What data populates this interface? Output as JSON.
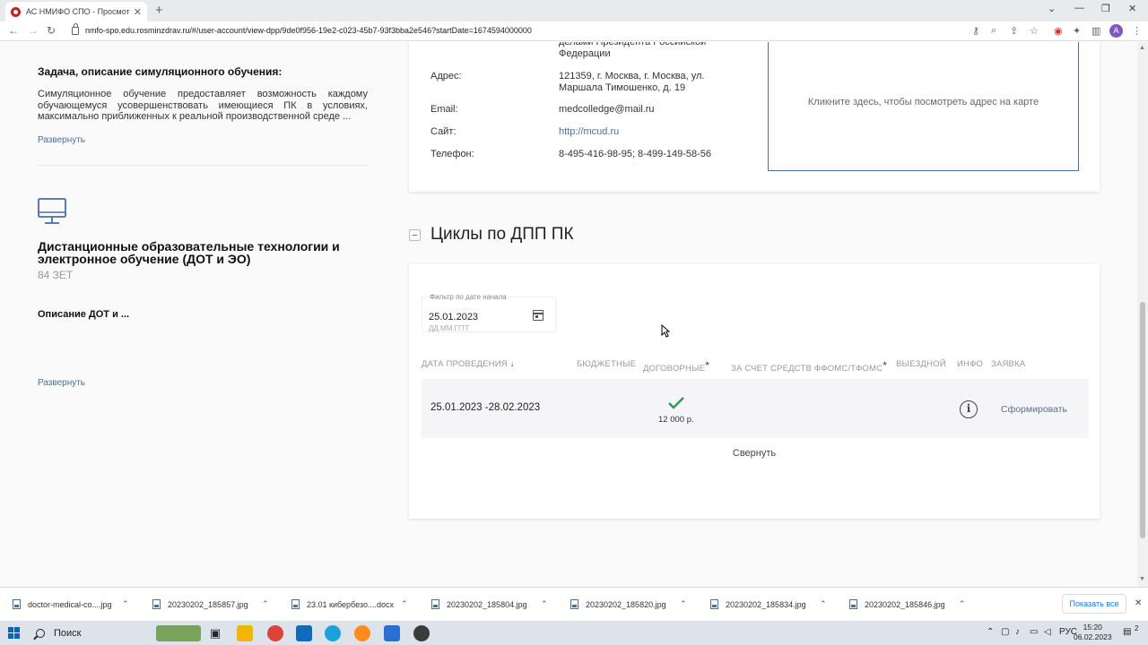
{
  "browser": {
    "tab_title": "АС НМИФО СПО - Просмотр Д",
    "url": "nmfo-spo.edu.rosminzdrav.ru/#/user-account/view-dpp/9de0f956-19e2-c023-45b7-93f3bba2e546?startDate=1674594000000"
  },
  "left": {
    "task_heading": "Задача, описание симуляционного обучения:",
    "task_text": "Симуляционное обучение предоставляет возможность каждому обучающемуся усовершенствовать имеющиеся ПК в условиях, максимально приближенных к реальной производственной среде ...",
    "expand_1": "Развернуть",
    "dot_title": "Дистанционные образовательные технологии и электронное обучение (ДОТ и ЭО)",
    "dot_zet": "84 ЗЕТ",
    "dot_desc": "Описание ДОТ и ...",
    "expand_2": "Развернуть"
  },
  "org_info": {
    "org_tail": "делами Президента Российской Федерации",
    "address_label": "Адрес:",
    "address_value": "121359, г. Москва, г. Москва, ул. Маршала Тимошенко, д. 19",
    "email_label": "Email:",
    "email_value": "medcolledge@mail.ru",
    "site_label": "Сайт:",
    "site_value": "http://mcud.ru",
    "phone_label": "Телефон:",
    "phone_value": "8-495-416-98-95; 8-499-149-58-56",
    "map_text": "Кликните здесь, чтобы посмотреть адрес на карте"
  },
  "cycles": {
    "section_title": "Циклы по ДПП ПК",
    "filter_label": "Фильтр по дате начала",
    "filter_value": "25.01.2023",
    "filter_hint": "ДД.ММ.ГГГГ",
    "columns": {
      "date": "ДАТА ПРОВЕДЕНИЯ",
      "budget": "БЮДЖЕТНЫЕ",
      "contract": "ДОГОВОРНЫЕ",
      "foms": "ЗА СЧЕТ СРЕДСТВ ФФОМС/ТФОМС",
      "offsite": "ВЫЕЗДНОЙ",
      "info": "ИНФО",
      "request": "ЗАЯВКА"
    },
    "asterisk": "*",
    "rows": [
      {
        "date": "25.01.2023 -28.02.2023",
        "contract_price": "12 000 р.",
        "request_link": "Сформировать"
      }
    ],
    "collapse": "Свернуть"
  },
  "downloads": {
    "items": [
      "doctor-medical-co....jpg",
      "20230202_185857.jpg",
      "23.01 кибербезо....docx",
      "20230202_185804.jpg",
      "20230202_185820.jpg",
      "20230202_185834.jpg",
      "20230202_185846.jpg"
    ],
    "show_all": "Показать все"
  },
  "taskbar": {
    "search": "Поиск",
    "lang": "РУС",
    "time": "15:20",
    "date": "06.02.2023",
    "notifications": "2"
  },
  "colors": {
    "accent_link": "#4a6fa5",
    "check_green": "#2e9b57"
  }
}
